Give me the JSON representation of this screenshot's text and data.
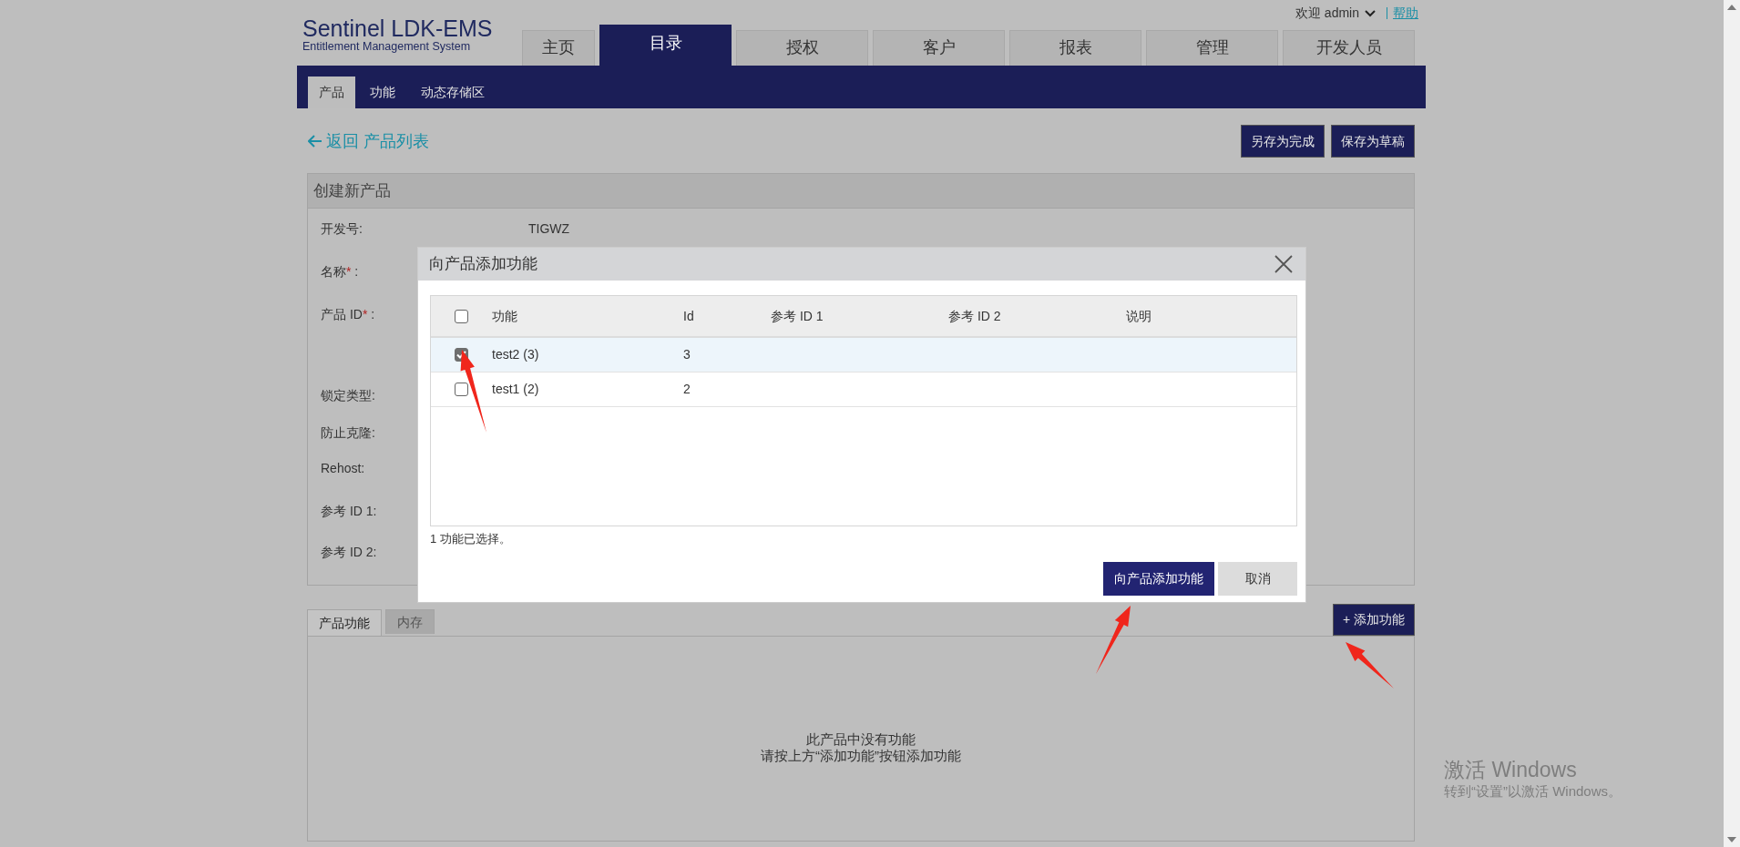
{
  "header": {
    "logo_title": "Sentinel LDK-EMS",
    "logo_subtitle": "Entitlement Management System",
    "welcome": "欢迎 admin",
    "help": "帮助",
    "tabs": [
      {
        "label": "主页",
        "selected": false
      },
      {
        "label": "目录",
        "selected": true
      },
      {
        "label": "授权",
        "selected": false
      },
      {
        "label": "客户",
        "selected": false
      },
      {
        "label": "报表",
        "selected": false
      },
      {
        "label": "管理",
        "selected": false
      },
      {
        "label": "开发人员",
        "selected": false
      }
    ]
  },
  "subtabs": [
    {
      "label": "产品",
      "selected": true
    },
    {
      "label": "功能",
      "selected": false
    },
    {
      "label": "动态存储区",
      "selected": false
    }
  ],
  "back_link": "返回 产品列表",
  "actions": [
    "另存为完成",
    "保存为草稿"
  ],
  "panel": {
    "title": "创建新产品",
    "fields": [
      {
        "label": "开发号:",
        "value": "TIGWZ"
      },
      {
        "label": "名称",
        "mark": "*",
        "colon": " :"
      },
      {
        "label": "产品 ID",
        "mark": "*",
        "colon": " :"
      },
      {
        "label": "锁定类型:"
      },
      {
        "label": "防止克隆:"
      },
      {
        "label": "Rehost:"
      },
      {
        "label": "参考 ID 1:"
      },
      {
        "label": "参考 ID 2:"
      }
    ]
  },
  "bottom_tabs": [
    {
      "label": "产品功能",
      "selected": true
    },
    {
      "label": "内存",
      "selected": false
    }
  ],
  "add_button": "+ 添加功能",
  "empty_message": [
    "此产品中没有功能",
    "请按上方“添加功能”按钮添加功能"
  ],
  "dialog": {
    "title": "向产品添加功能",
    "select_all_checked": false,
    "columns": [
      "功能",
      "Id",
      "参考 ID 1",
      "参考 ID 2",
      "说明"
    ],
    "rows": [
      {
        "checked": true,
        "cells": [
          "test2 (3)",
          "3"
        ]
      },
      {
        "checked": false,
        "cells": [
          "test1 (2)",
          "2"
        ]
      }
    ],
    "selection_note": "1 功能已选择。",
    "buttons": [
      {
        "label": "向产品添加功能",
        "kind": "primary"
      },
      {
        "label": "取消",
        "kind": "secondary"
      }
    ]
  },
  "activation_notice": {
    "title": "激活 Windows",
    "subtitle": "转到“设置”以激活 Windows。"
  }
}
